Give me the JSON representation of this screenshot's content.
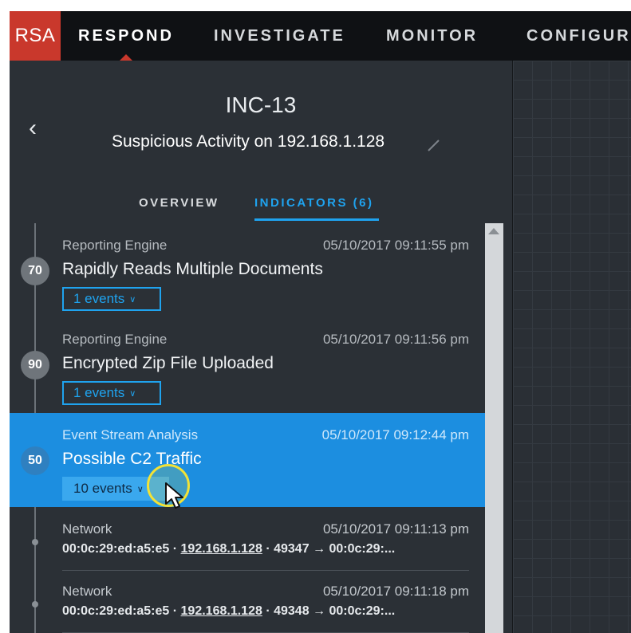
{
  "nav": {
    "logo": "RSA",
    "items": [
      {
        "label": "RESPOND",
        "active": true
      },
      {
        "label": "INVESTIGATE",
        "active": false
      },
      {
        "label": "MONITOR",
        "active": false
      },
      {
        "label": "CONFIGUR",
        "active": false
      }
    ]
  },
  "incident": {
    "id": "INC-13",
    "title": "Suspicious Activity on 192.168.1.128"
  },
  "tabs": [
    {
      "label": "OVERVIEW",
      "active": false
    },
    {
      "label": "INDICATORS (6)",
      "active": true
    }
  ],
  "indicators": [
    {
      "score": "70",
      "source": "Reporting Engine",
      "time": "05/10/2017 09:11:55 pm",
      "name": "Rapidly Reads Multiple Documents",
      "events": "1 events",
      "selected": false
    },
    {
      "score": "90",
      "source": "Reporting Engine",
      "time": "05/10/2017 09:11:56 pm",
      "name": "Encrypted Zip File Uploaded",
      "events": "1 events",
      "selected": false
    },
    {
      "score": "50",
      "source": "Event Stream Analysis",
      "time": "05/10/2017 09:12:44 pm",
      "name": "Possible C2 Traffic",
      "events": "10 events",
      "selected": true
    }
  ],
  "events": [
    {
      "source": "Network",
      "time": "05/10/2017 09:11:13 pm",
      "src_mac": "00:0c:29:ed:a5:e5",
      "sep1": "·",
      "ip": "192.168.1.128",
      "sep2": "·",
      "port": "49347",
      "arrow": "→",
      "dst": "00:0c:29:..."
    },
    {
      "source": "Network",
      "time": "05/10/2017 09:11:18 pm",
      "src_mac": "00:0c:29:ed:a5:e5",
      "sep1": "·",
      "ip": "192.168.1.128",
      "sep2": "·",
      "port": "49348",
      "arrow": "→",
      "dst": "00:0c:29:..."
    }
  ],
  "colors": {
    "brand": "#c9382c",
    "accent": "#1fa3ef",
    "selected_row": "#1c8ee0",
    "cursor_highlight": "#f3e236"
  },
  "icons": [
    "back-chevron-icon",
    "edit-pencil-icon",
    "chevron-down-icon",
    "scroll-up-arrow-icon",
    "mouse-pointer-icon"
  ]
}
